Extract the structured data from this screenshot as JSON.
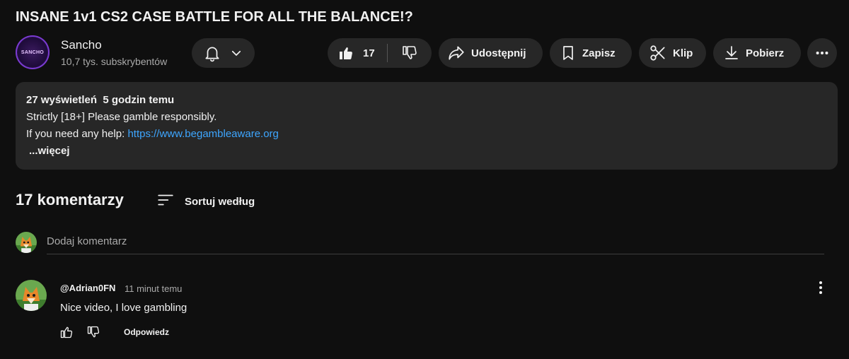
{
  "video": {
    "title": "INSANE 1v1 CS2 CASE BATTLE FOR ALL THE BALANCE!?"
  },
  "channel": {
    "name": "Sancho",
    "subscribers": "10,7 tys. subskrybentów",
    "avatar_text": "SANCHO",
    "avatar_icon": "channel-avatar"
  },
  "actions": {
    "likes": "17",
    "share_label": "Udostępnij",
    "save_label": "Zapisz",
    "clip_label": "Klip",
    "download_label": "Pobierz"
  },
  "description": {
    "meta": "27 wyświetleń  5 godzin temu",
    "line1": "Strictly [18+] Please gamble responsibly.",
    "line2_prefix": "If you need any help: ",
    "link": "https://www.begambleaware.org",
    "more": "...więcej"
  },
  "comments": {
    "count_label": "17 komentarzy",
    "sort_label": "Sortuj według",
    "add_placeholder": "Dodaj komentarz",
    "items": [
      {
        "author": "@Adrian0FN",
        "time": "11 minut temu",
        "text": "Nice video, I love gambling",
        "reply_label": "Odpowiedz"
      }
    ]
  },
  "colors": {
    "background": "#0f0f0f",
    "surface": "#272727",
    "link": "#3ea6ff",
    "text": "#f1f1f1",
    "secondary_text": "#aaaaaa"
  }
}
